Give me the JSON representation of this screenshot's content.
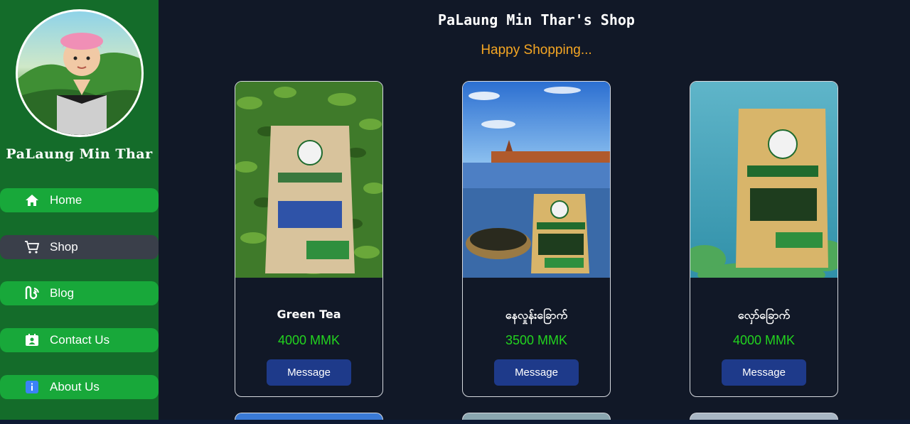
{
  "sidebar": {
    "brand": "PaLaung Min Thar",
    "items": [
      {
        "label": "Home",
        "icon": "home-icon"
      },
      {
        "label": "Shop",
        "icon": "cart-icon"
      },
      {
        "label": "Blog",
        "icon": "blog-icon"
      },
      {
        "label": "Contact Us",
        "icon": "contact-icon"
      },
      {
        "label": "About Us",
        "icon": "info-icon"
      }
    ],
    "active": "Shop"
  },
  "header": {
    "title": "PaLaung Min Thar's Shop",
    "tagline": "Happy Shopping..."
  },
  "products": [
    {
      "name": "Green Tea",
      "price": "4000 MMK",
      "button": "Message"
    },
    {
      "name": "နေလှုန်းခြောက်",
      "price": "3500 MMK",
      "button": "Message"
    },
    {
      "name": "လှော်ခြောက်",
      "price": "4000 MMK",
      "button": "Message"
    }
  ],
  "colors": {
    "sidebar_bg": "#146c2a",
    "nav_green": "#18a83a",
    "nav_active": "#3a3f4a",
    "page_bg": "#111827",
    "tagline": "#f5a623",
    "price": "#22d31f",
    "button": "#1e3a8a"
  }
}
